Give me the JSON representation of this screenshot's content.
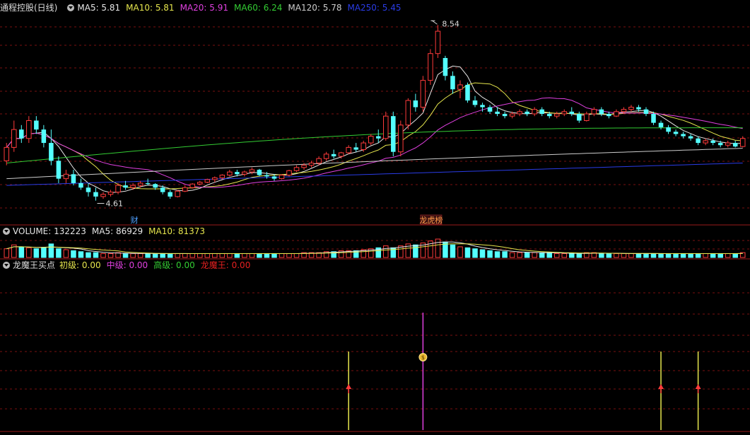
{
  "main_panel": {
    "title": "通程控股(日线)",
    "ma_items": [
      {
        "label": "MA5: 5.81",
        "color": "#e6e6e6"
      },
      {
        "label": "MA10: 5.81",
        "color": "#e6e64d"
      },
      {
        "label": "MA20: 5.91",
        "color": "#e040e0"
      },
      {
        "label": "MA60: 6.24",
        "color": "#33cc33"
      },
      {
        "label": "MA120: 5.78",
        "color": "#cccccc"
      },
      {
        "label": "MA250: 5.45",
        "color": "#2a3ce6"
      }
    ],
    "high_label": "8.54",
    "low_label": "4.61",
    "event_label_1": "财",
    "event_label_2": "龙虎榜"
  },
  "volume_panel": {
    "items": [
      {
        "label": "VOLUME: 132223",
        "color": "#e6e6e6"
      },
      {
        "label": "MA5: 86929",
        "color": "#e6e6e6"
      },
      {
        "label": "MA10: 81373",
        "color": "#e6e64d"
      }
    ]
  },
  "indicator_panel": {
    "title": "龙魔王买点",
    "items": [
      {
        "label": "初级: 0.00",
        "color": "#e6e64d"
      },
      {
        "label": "中级: 0.00",
        "color": "#e040e0"
      },
      {
        "label": "高级: 0.00",
        "color": "#33cc33"
      },
      {
        "label": "龙魔王: 0.00",
        "color": "#e62020"
      }
    ]
  },
  "colors": {
    "up": "#ff3b3b",
    "down": "#54ffff",
    "grid": "#7a1010",
    "separator": "#9a1a1a"
  },
  "chart_data": {
    "type": "candlestick",
    "price_high": 8.54,
    "price_low": 4.61,
    "ma_last": {
      "MA5": 5.81,
      "MA10": 5.81,
      "MA20": 5.91,
      "MA60": 6.24,
      "MA120": 5.78,
      "MA250": 5.45
    },
    "volume_last": 132223,
    "volume_ma5": 86929,
    "volume_ma10": 81373,
    "candles_ohlc": [
      [
        5.5,
        5.9,
        5.4,
        5.8
      ],
      [
        5.8,
        6.4,
        5.7,
        6.2
      ],
      [
        6.2,
        6.3,
        5.9,
        6.0
      ],
      [
        6.0,
        6.5,
        5.9,
        6.4
      ],
      [
        6.4,
        6.5,
        6.1,
        6.2
      ],
      [
        6.2,
        6.3,
        5.8,
        5.9
      ],
      [
        5.9,
        6.2,
        5.4,
        5.5
      ],
      [
        5.5,
        5.6,
        5.0,
        5.1
      ],
      [
        5.1,
        5.3,
        5.0,
        5.2
      ],
      [
        5.2,
        5.3,
        4.95,
        5.0
      ],
      [
        5.0,
        5.1,
        4.85,
        4.9
      ],
      [
        4.9,
        5.0,
        4.7,
        4.8
      ],
      [
        4.8,
        4.9,
        4.61,
        4.7
      ],
      [
        4.7,
        4.8,
        4.65,
        4.75
      ],
      [
        4.75,
        4.85,
        4.7,
        4.8
      ],
      [
        4.8,
        5.0,
        4.75,
        4.95
      ],
      [
        4.95,
        5.05,
        4.85,
        4.9
      ],
      [
        4.9,
        5.0,
        4.85,
        4.95
      ],
      [
        4.95,
        5.05,
        4.9,
        5.0
      ],
      [
        5.0,
        5.1,
        4.95,
        4.98
      ],
      [
        4.98,
        5.0,
        4.85,
        4.9
      ],
      [
        4.9,
        4.95,
        4.75,
        4.8
      ],
      [
        4.8,
        4.85,
        4.65,
        4.7
      ],
      [
        4.7,
        4.85,
        4.68,
        4.82
      ],
      [
        4.82,
        4.95,
        4.8,
        4.9
      ],
      [
        4.9,
        5.0,
        4.88,
        4.98
      ],
      [
        4.98,
        5.05,
        4.95,
        5.02
      ],
      [
        5.02,
        5.1,
        5.0,
        5.08
      ],
      [
        5.08,
        5.15,
        5.02,
        5.12
      ],
      [
        5.12,
        5.2,
        5.08,
        5.18
      ],
      [
        5.18,
        5.3,
        5.15,
        5.25
      ],
      [
        5.25,
        5.3,
        5.15,
        5.2
      ],
      [
        5.2,
        5.28,
        5.15,
        5.25
      ],
      [
        5.25,
        5.35,
        5.2,
        5.3
      ],
      [
        5.3,
        5.32,
        5.15,
        5.18
      ],
      [
        5.18,
        5.25,
        5.1,
        5.15
      ],
      [
        5.15,
        5.2,
        5.05,
        5.1
      ],
      [
        5.1,
        5.2,
        5.08,
        5.18
      ],
      [
        5.18,
        5.3,
        5.15,
        5.28
      ],
      [
        5.28,
        5.4,
        5.25,
        5.35
      ],
      [
        5.35,
        5.45,
        5.3,
        5.4
      ],
      [
        5.4,
        5.5,
        5.35,
        5.45
      ],
      [
        5.45,
        5.6,
        5.4,
        5.55
      ],
      [
        5.55,
        5.7,
        5.5,
        5.65
      ],
      [
        5.65,
        5.75,
        5.55,
        5.6
      ],
      [
        5.6,
        5.7,
        5.55,
        5.68
      ],
      [
        5.68,
        5.85,
        5.65,
        5.8
      ],
      [
        5.8,
        5.9,
        5.7,
        5.75
      ],
      [
        5.75,
        5.95,
        5.7,
        5.9
      ],
      [
        5.9,
        6.1,
        5.85,
        6.05
      ],
      [
        6.05,
        6.2,
        5.9,
        6.0
      ],
      [
        6.0,
        6.6,
        5.95,
        6.5
      ],
      [
        6.5,
        6.6,
        5.6,
        5.7
      ],
      [
        5.7,
        6.4,
        5.6,
        6.3
      ],
      [
        6.3,
        6.9,
        6.2,
        6.85
      ],
      [
        6.85,
        7.0,
        6.6,
        6.7
      ],
      [
        6.7,
        7.4,
        6.6,
        7.3
      ],
      [
        7.3,
        8.0,
        7.2,
        7.9
      ],
      [
        7.9,
        8.54,
        7.8,
        8.4
      ],
      [
        7.8,
        7.85,
        7.3,
        7.4
      ],
      [
        7.4,
        7.5,
        7.0,
        7.1
      ],
      [
        7.1,
        7.3,
        6.9,
        7.2
      ],
      [
        7.2,
        7.25,
        6.8,
        6.85
      ],
      [
        6.85,
        6.95,
        6.7,
        6.75
      ],
      [
        6.75,
        6.8,
        6.6,
        6.7
      ],
      [
        6.7,
        6.75,
        6.55,
        6.6
      ],
      [
        6.6,
        6.7,
        6.5,
        6.55
      ],
      [
        6.55,
        6.6,
        6.45,
        6.5
      ],
      [
        6.5,
        6.6,
        6.45,
        6.55
      ],
      [
        6.55,
        6.65,
        6.5,
        6.6
      ],
      [
        6.6,
        6.65,
        6.5,
        6.55
      ],
      [
        6.55,
        6.7,
        6.5,
        6.65
      ],
      [
        6.65,
        6.7,
        6.5,
        6.55
      ],
      [
        6.55,
        6.6,
        6.45,
        6.5
      ],
      [
        6.5,
        6.6,
        6.45,
        6.55
      ],
      [
        6.55,
        6.65,
        6.5,
        6.6
      ],
      [
        6.6,
        6.7,
        6.5,
        6.55
      ],
      [
        6.55,
        6.6,
        6.35,
        6.4
      ],
      [
        6.4,
        6.6,
        6.38,
        6.55
      ],
      [
        6.55,
        6.7,
        6.5,
        6.65
      ],
      [
        6.65,
        6.7,
        6.5,
        6.55
      ],
      [
        6.55,
        6.6,
        6.45,
        6.5
      ],
      [
        6.5,
        6.65,
        6.48,
        6.6
      ],
      [
        6.6,
        6.7,
        6.55,
        6.65
      ],
      [
        6.65,
        6.75,
        6.6,
        6.7
      ],
      [
        6.7,
        6.75,
        6.6,
        6.65
      ],
      [
        6.65,
        6.7,
        6.5,
        6.55
      ],
      [
        6.55,
        6.6,
        6.3,
        6.35
      ],
      [
        6.35,
        6.4,
        6.2,
        6.25
      ],
      [
        6.25,
        6.3,
        6.1,
        6.15
      ],
      [
        6.15,
        6.2,
        6.05,
        6.1
      ],
      [
        6.1,
        6.15,
        6.0,
        6.05
      ],
      [
        6.05,
        6.1,
        5.95,
        6.0
      ],
      [
        6.0,
        6.05,
        5.85,
        5.9
      ],
      [
        5.9,
        6.0,
        5.85,
        5.95
      ],
      [
        5.95,
        6.0,
        5.85,
        5.9
      ],
      [
        5.9,
        5.95,
        5.8,
        5.85
      ],
      [
        5.85,
        5.95,
        5.8,
        5.9
      ],
      [
        5.9,
        5.95,
        5.8,
        5.82
      ],
      [
        5.82,
        6.05,
        5.8,
        6.0
      ]
    ],
    "volumes": [
      9,
      13,
      11,
      10,
      9,
      10,
      14,
      9,
      8,
      7,
      6,
      5,
      5,
      4,
      4,
      5,
      4,
      4,
      4,
      4,
      4,
      4,
      4,
      4,
      4,
      4,
      4,
      4,
      4,
      4,
      4,
      4,
      4,
      4,
      4,
      4,
      4,
      4,
      4,
      4,
      5,
      5,
      5,
      6,
      6,
      7,
      7,
      7,
      8,
      9,
      10,
      12,
      10,
      12,
      14,
      13,
      15,
      17,
      19,
      16,
      13,
      11,
      10,
      9,
      8,
      7,
      6,
      6,
      5,
      5,
      5,
      5,
      5,
      5,
      4,
      4,
      4,
      4,
      5,
      5,
      4,
      4,
      4,
      4,
      4,
      4,
      4,
      4,
      4,
      4,
      4,
      4,
      4,
      4,
      4,
      4,
      4,
      4,
      4,
      5
    ],
    "buy_signals": [
      {
        "candle_index": 46,
        "level": "初级"
      },
      {
        "candle_index": 56,
        "level": "中级"
      },
      {
        "candle_index": 88,
        "level": "初级"
      },
      {
        "candle_index": 93,
        "level": "初级"
      }
    ]
  }
}
